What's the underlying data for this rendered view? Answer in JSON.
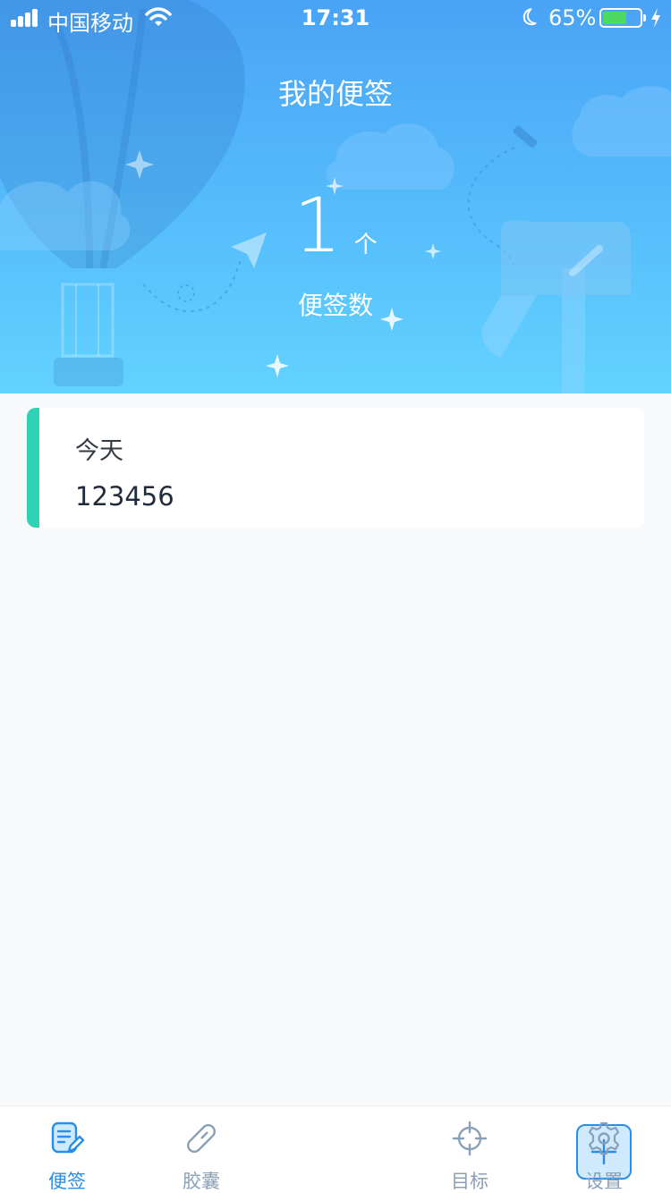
{
  "status_bar": {
    "carrier": "中国移动",
    "time": "17:31",
    "battery_percent": "65%",
    "battery_level": 0.65
  },
  "header": {
    "title": "我的便签",
    "count": "1",
    "count_unit": "个",
    "count_label": "便签数"
  },
  "notes": [
    {
      "date": "今天",
      "text": "123456",
      "accent_color": "#2ed3b6"
    }
  ],
  "tabbar": {
    "items": [
      {
        "label": "便签",
        "icon": "note-edit-icon",
        "active": true
      },
      {
        "label": "胶囊",
        "icon": "capsule-icon",
        "active": false
      },
      {
        "label": "",
        "icon": "plus-icon",
        "active": false
      },
      {
        "label": "目标",
        "icon": "target-icon",
        "active": false
      },
      {
        "label": "设置",
        "icon": "gear-icon",
        "active": false
      }
    ]
  },
  "colors": {
    "accent": "#2a8de6",
    "tab_inactive": "#8aa0b6",
    "note_accent": "#2ed3b6",
    "hero_top": "#4aa3f6",
    "hero_bottom": "#62d2ff"
  }
}
